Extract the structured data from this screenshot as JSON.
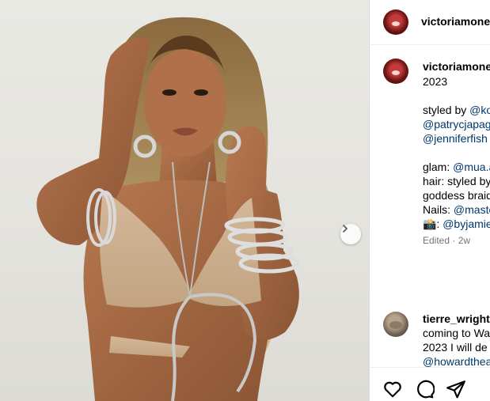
{
  "post": {
    "author": "victoriamonet",
    "image_alt": "",
    "carousel_next_icon": "chevron-right-icon"
  },
  "caption": {
    "username": "victoriamonet",
    "lines": [
      {
        "text": "2023",
        "mention": ""
      },
      {
        "text": "",
        "mention": ""
      },
      {
        "text": "styled by ",
        "mention": "@ko"
      },
      {
        "text": "",
        "mention": "@patrycjapag"
      },
      {
        "text": "",
        "mention": "@jenniferfish"
      },
      {
        "text": "",
        "mention": ""
      },
      {
        "text": "glam: ",
        "mention": "@mua.a"
      },
      {
        "text": "hair: styled by",
        "mention": ""
      },
      {
        "text": "goddess braid",
        "mention": ""
      },
      {
        "text": "Nails: ",
        "mention": "@maste"
      },
      {
        "text": "📸: ",
        "mention": "@byjamie"
      }
    ],
    "meta": "Edited · 2w"
  },
  "comment": {
    "username": "tierre_wright",
    "lines": [
      {
        "text": "coming to Wa",
        "mention": ""
      },
      {
        "text": "2023 I will de",
        "mention": ""
      },
      {
        "text": "",
        "mention": "@howardthea"
      }
    ]
  },
  "actions": {
    "like_icon": "heart-icon",
    "comment_icon": "comment-icon",
    "share_icon": "share-icon"
  },
  "colors": {
    "mention": "#00376b",
    "meta": "#737373",
    "divider": "#dbdbdb"
  }
}
